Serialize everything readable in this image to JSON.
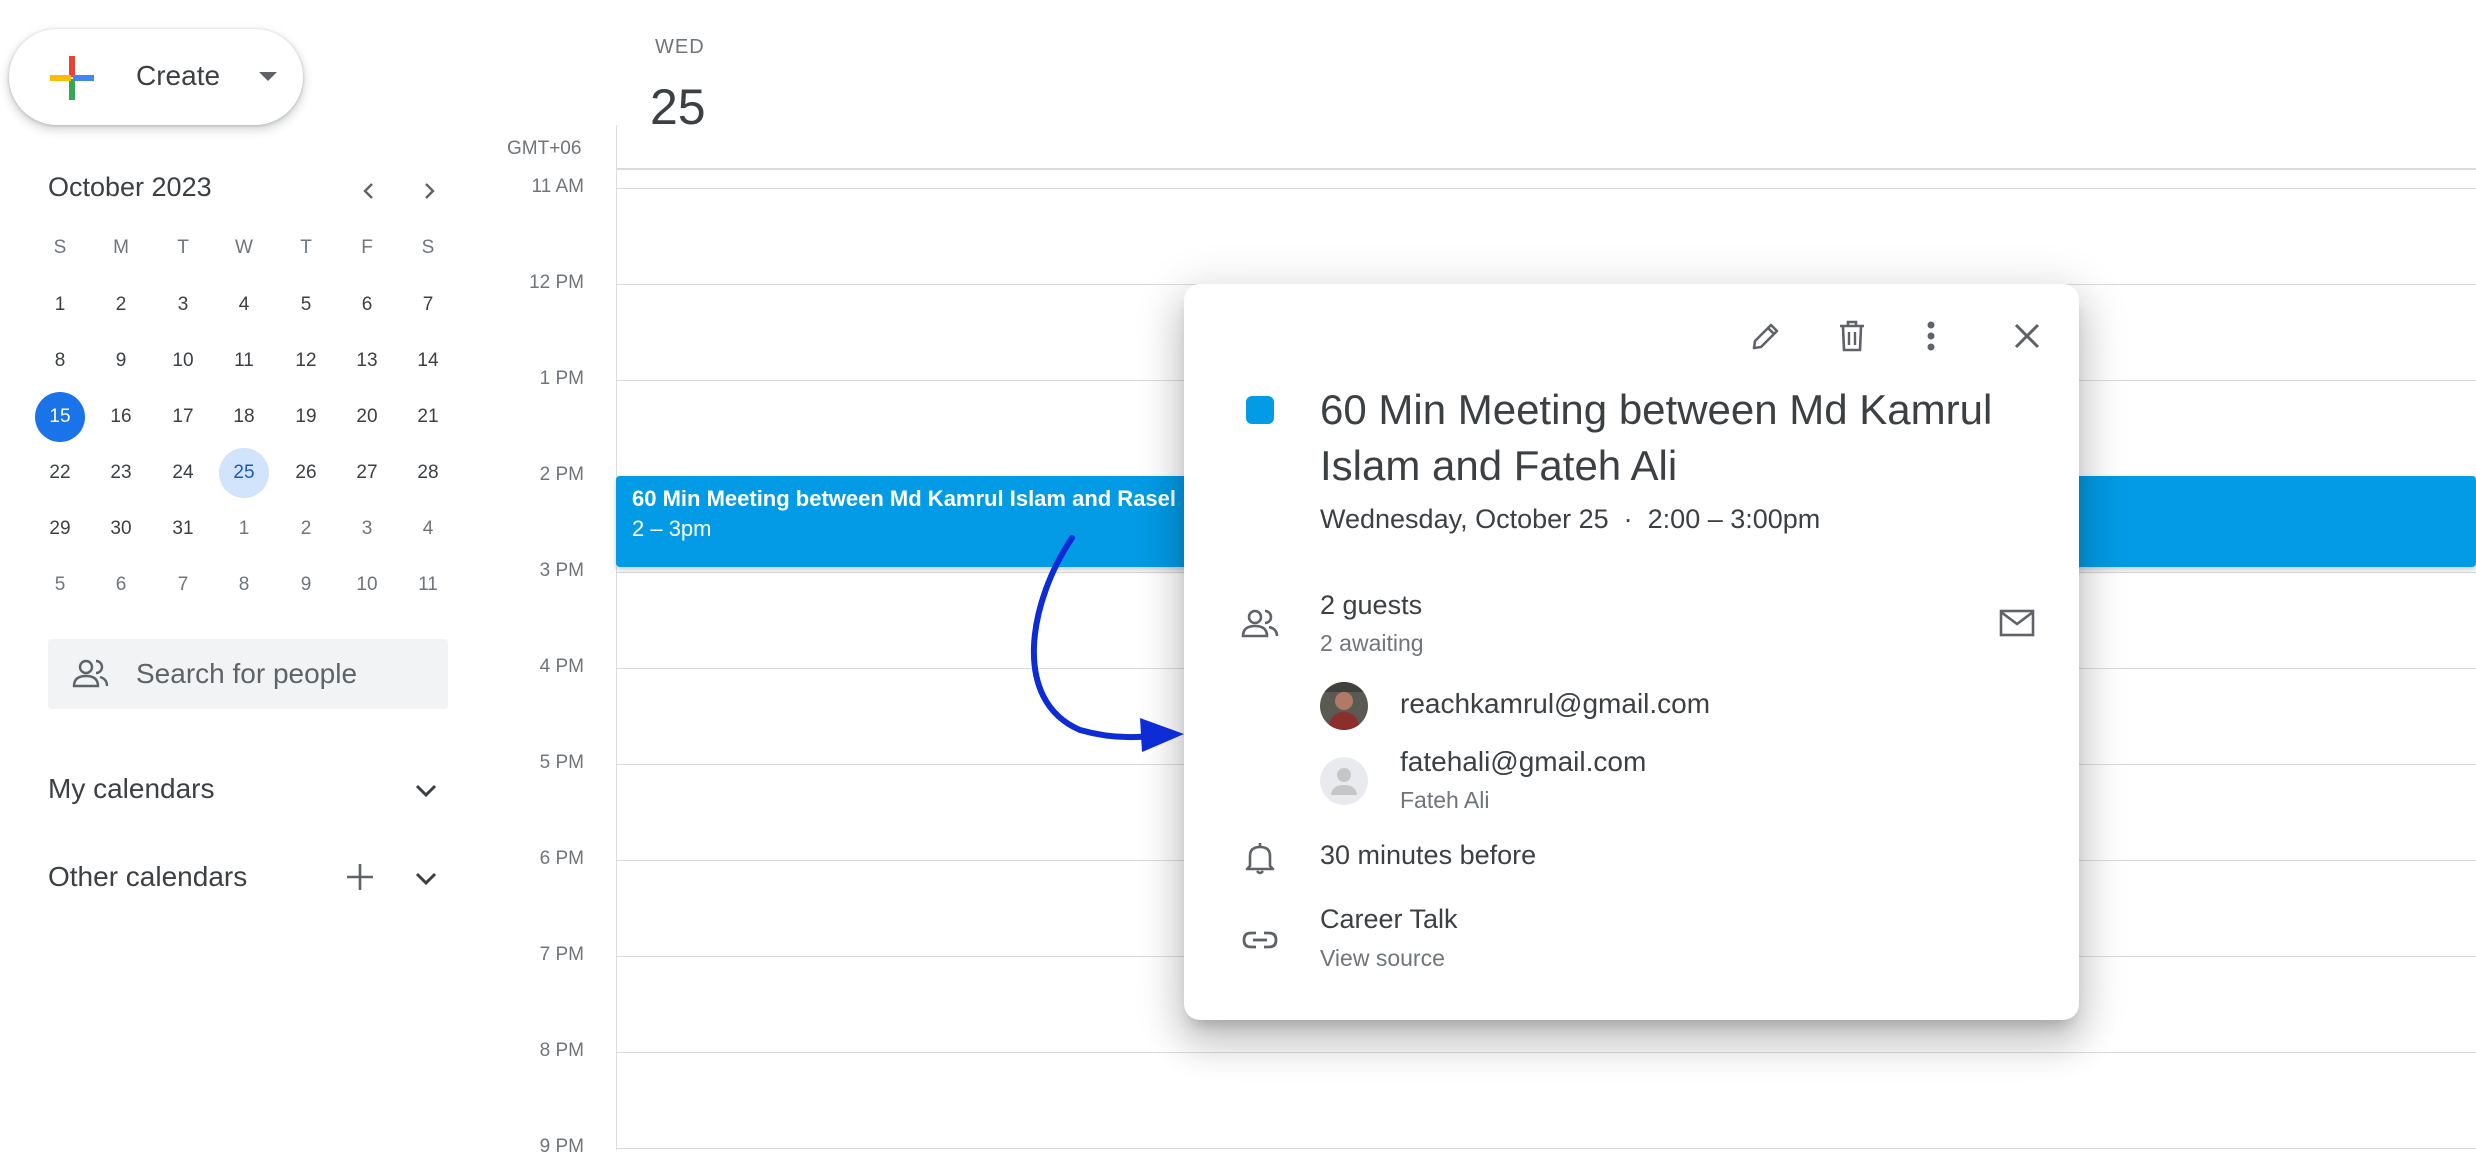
{
  "create": {
    "label": "Create"
  },
  "mini_calendar": {
    "title": "October 2023",
    "dow": [
      "S",
      "M",
      "T",
      "W",
      "T",
      "F",
      "S"
    ],
    "weeks": [
      [
        "1",
        "2",
        "3",
        "4",
        "5",
        "6",
        "7"
      ],
      [
        "8",
        "9",
        "10",
        "11",
        "12",
        "13",
        "14"
      ],
      [
        "15",
        "16",
        "17",
        "18",
        "19",
        "20",
        "21"
      ],
      [
        "22",
        "23",
        "24",
        "25",
        "26",
        "27",
        "28"
      ],
      [
        "29",
        "30",
        "31",
        "1",
        "2",
        "3",
        "4"
      ],
      [
        "5",
        "6",
        "7",
        "8",
        "9",
        "10",
        "11"
      ]
    ],
    "today": "15",
    "selected": "25"
  },
  "search_people": {
    "placeholder": "Search for people"
  },
  "my_calendars": {
    "label": "My calendars"
  },
  "other_calendars": {
    "label": "Other calendars"
  },
  "day_header": {
    "dow": "WED",
    "date": "25",
    "timezone": "GMT+06"
  },
  "hours": [
    "11 AM",
    "12 PM",
    "1 PM",
    "2 PM",
    "3 PM",
    "4 PM",
    "5 PM",
    "6 PM",
    "7 PM",
    "8 PM",
    "9 PM"
  ],
  "event": {
    "title": "60 Min Meeting between Md Kamrul Islam and Rasel",
    "time": "2 – 3pm",
    "color": "#039be5"
  },
  "popup": {
    "title": "60 Min Meeting between Md Kamrul Islam and Fateh Ali",
    "when": "Wednesday, October 25  ·  2:00 – 3:00pm",
    "guests_count": "2 guests",
    "guests_status": "2 awaiting",
    "guests": [
      {
        "email": "reachkamrul@gmail.com",
        "name": ""
      },
      {
        "email": "fatehali@gmail.com",
        "name": "Fateh Ali"
      }
    ],
    "reminder": "30 minutes before",
    "source_title": "Career Talk",
    "source_link": "View source"
  },
  "accent_color": "#1a73e8",
  "annotation_arrow_color": "#0d2cd6"
}
